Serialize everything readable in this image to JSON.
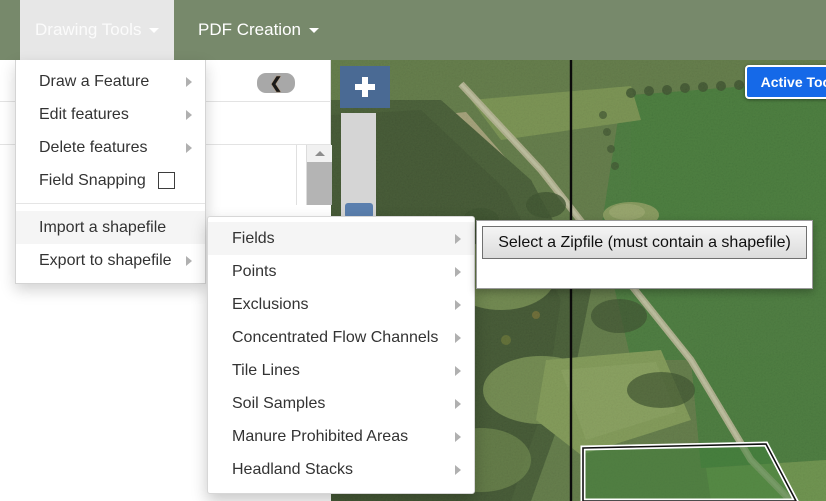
{
  "navbar": {
    "items": [
      {
        "id": "drawing-tools",
        "label": "Drawing Tools",
        "caret": "caret-down-icon",
        "active": true
      },
      {
        "id": "pdf-creation",
        "label": "PDF Creation",
        "caret": "caret-down-icon",
        "active": false
      }
    ]
  },
  "drawing_tools_menu": {
    "group1": [
      {
        "label": "Draw a Feature",
        "submenu": true,
        "highlight": false
      },
      {
        "label": "Edit features",
        "submenu": true,
        "highlight": false
      },
      {
        "label": "Delete features",
        "submenu": true,
        "highlight": false
      },
      {
        "label": "Field Snapping",
        "submenu": false,
        "checkbox": true,
        "checked": false,
        "highlight": false
      }
    ],
    "group2": [
      {
        "label": "Import a shapefile",
        "submenu": false,
        "highlight": true
      },
      {
        "label": "Export to shapefile",
        "submenu": true,
        "highlight": false
      }
    ]
  },
  "feature_submenu": {
    "items": [
      {
        "label": "Fields",
        "submenu": true,
        "highlight": true
      },
      {
        "label": "Points",
        "submenu": true,
        "highlight": false
      },
      {
        "label": "Exclusions",
        "submenu": true,
        "highlight": false
      },
      {
        "label": "Concentrated Flow Channels",
        "submenu": true,
        "highlight": false
      },
      {
        "label": "Tile Lines",
        "submenu": true,
        "highlight": false
      },
      {
        "label": "Soil Samples",
        "submenu": true,
        "highlight": false
      },
      {
        "label": "Manure Prohibited Areas",
        "submenu": true,
        "highlight": false
      },
      {
        "label": "Headland Stacks",
        "submenu": true,
        "highlight": false
      }
    ]
  },
  "zipfile_popup": {
    "button_label": "Select a Zipfile (must contain a shapefile)"
  },
  "map": {
    "active_tool_badge": "Active Tool: Edit",
    "zoom_in_label": "+",
    "zoom_control_name": "zoom-slider"
  },
  "sidebar": {
    "collapse_icon": "chevron-left-icon",
    "expand_icon": "chevron-down-icon",
    "scrollbar_up_icon": "chevron-up-icon"
  },
  "colors": {
    "navbar_green": "#77896b",
    "active_nav_bg": "#e7e7e7",
    "badge_blue": "#1569e8",
    "menu_highlight": "#f5f5f5",
    "zoom_button_blue": "#4a6a94"
  }
}
